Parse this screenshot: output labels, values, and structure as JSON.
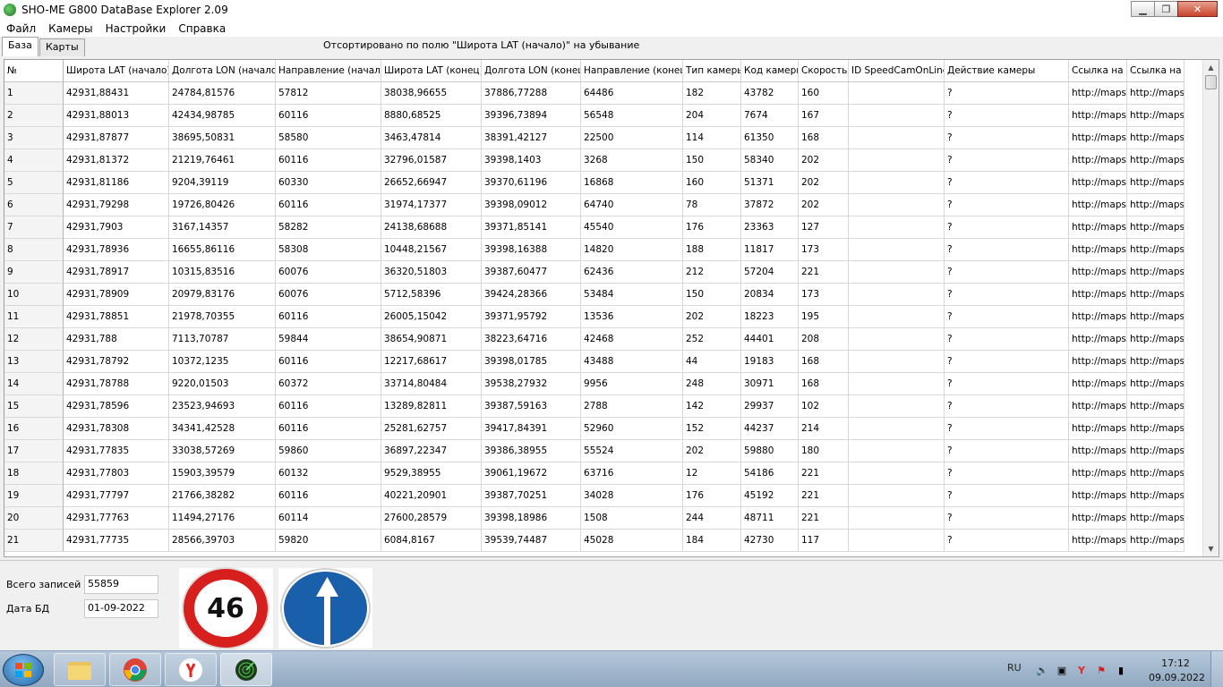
{
  "window": {
    "title": "SHO-ME G800 DataBase Explorer 2.09",
    "minimize_symbol": "▁",
    "maximize_symbol": "❐",
    "close_symbol": "✕"
  },
  "menu": [
    "Файл",
    "Камеры",
    "Настройки",
    "Справка"
  ],
  "tabs": [
    {
      "label": "База",
      "active": true
    },
    {
      "label": "Карты",
      "active": false
    }
  ],
  "sort_info": "Отсортировано по полю \"Широта LAT (начало)\" на убывание",
  "table": {
    "columns": [
      "№",
      "Широта LAT (начало)",
      "Долгота LON (начало)",
      "Направление (начало)",
      "Широта LAT (конец)",
      "Долгота LON (конец)",
      "Направление (конец)",
      "Тип камеры",
      "Код камеры",
      "Скорость",
      "ID SpeedCamOnLine",
      "Действие камеры",
      "Ссылка на Google",
      "Ссылка на Яндекс"
    ],
    "rows": [
      [
        "1",
        "42931,88431",
        "24784,81576",
        "57812",
        "38038,96655",
        "37886,77288",
        "64486",
        "182",
        "43782",
        "160",
        "",
        "?",
        "http://maps.",
        "http://maps."
      ],
      [
        "2",
        "42931,88013",
        "42434,98785",
        "60116",
        "8880,68525",
        "39396,73894",
        "56548",
        "204",
        "7674",
        "167",
        "",
        "?",
        "http://maps.",
        "http://maps."
      ],
      [
        "3",
        "42931,87877",
        "38695,50831",
        "58580",
        "3463,47814",
        "38391,42127",
        "22500",
        "114",
        "61350",
        "168",
        "",
        "?",
        "http://maps.",
        "http://maps."
      ],
      [
        "4",
        "42931,81372",
        "21219,76461",
        "60116",
        "32796,01587",
        "39398,1403",
        "3268",
        "150",
        "58340",
        "202",
        "",
        "?",
        "http://maps.",
        "http://maps."
      ],
      [
        "5",
        "42931,81186",
        "9204,39119",
        "60330",
        "26652,66947",
        "39370,61196",
        "16868",
        "160",
        "51371",
        "202",
        "",
        "?",
        "http://maps.",
        "http://maps."
      ],
      [
        "6",
        "42931,79298",
        "19726,80426",
        "60116",
        "31974,17377",
        "39398,09012",
        "64740",
        "78",
        "37872",
        "202",
        "",
        "?",
        "http://maps.",
        "http://maps."
      ],
      [
        "7",
        "42931,7903",
        "3167,14357",
        "58282",
        "24138,68688",
        "39371,85141",
        "45540",
        "176",
        "23363",
        "127",
        "",
        "?",
        "http://maps.",
        "http://maps."
      ],
      [
        "8",
        "42931,78936",
        "16655,86116",
        "58308",
        "10448,21567",
        "39398,16388",
        "14820",
        "188",
        "11817",
        "173",
        "",
        "?",
        "http://maps.",
        "http://maps."
      ],
      [
        "9",
        "42931,78917",
        "10315,83516",
        "60076",
        "36320,51803",
        "39387,60477",
        "62436",
        "212",
        "57204",
        "221",
        "",
        "?",
        "http://maps.",
        "http://maps."
      ],
      [
        "10",
        "42931,78909",
        "20979,83176",
        "60076",
        "5712,58396",
        "39424,28366",
        "53484",
        "150",
        "20834",
        "173",
        "",
        "?",
        "http://maps.",
        "http://maps."
      ],
      [
        "11",
        "42931,78851",
        "21978,70355",
        "60116",
        "26005,15042",
        "39371,95792",
        "13536",
        "202",
        "18223",
        "195",
        "",
        "?",
        "http://maps.",
        "http://maps."
      ],
      [
        "12",
        "42931,788",
        "7113,70787",
        "59844",
        "38654,90871",
        "38223,64716",
        "42468",
        "252",
        "44401",
        "208",
        "",
        "?",
        "http://maps.",
        "http://maps."
      ],
      [
        "13",
        "42931,78792",
        "10372,1235",
        "60116",
        "12217,68617",
        "39398,01785",
        "43488",
        "44",
        "19183",
        "168",
        "",
        "?",
        "http://maps.",
        "http://maps."
      ],
      [
        "14",
        "42931,78788",
        "9220,01503",
        "60372",
        "33714,80484",
        "39538,27932",
        "9956",
        "248",
        "30971",
        "168",
        "",
        "?",
        "http://maps.",
        "http://maps."
      ],
      [
        "15",
        "42931,78596",
        "23523,94693",
        "60116",
        "13289,82811",
        "39387,59163",
        "2788",
        "142",
        "29937",
        "102",
        "",
        "?",
        "http://maps.",
        "http://maps."
      ],
      [
        "16",
        "42931,78308",
        "34341,42528",
        "60116",
        "25281,62757",
        "39417,84391",
        "52960",
        "152",
        "44237",
        "214",
        "",
        "?",
        "http://maps.",
        "http://maps."
      ],
      [
        "17",
        "42931,77835",
        "33038,57269",
        "59860",
        "36897,22347",
        "39386,38955",
        "55524",
        "202",
        "59880",
        "180",
        "",
        "?",
        "http://maps.",
        "http://maps."
      ],
      [
        "18",
        "42931,77803",
        "15903,39579",
        "60132",
        "9529,38955",
        "39061,19672",
        "63716",
        "12",
        "54186",
        "221",
        "",
        "?",
        "http://maps.",
        "http://maps."
      ],
      [
        "19",
        "42931,77797",
        "21766,38282",
        "60116",
        "40221,20901",
        "39387,70251",
        "34028",
        "176",
        "45192",
        "221",
        "",
        "?",
        "http://maps.",
        "http://maps."
      ],
      [
        "20",
        "42931,77763",
        "11494,27176",
        "60114",
        "27600,28579",
        "39398,18986",
        "1508",
        "244",
        "48711",
        "221",
        "",
        "?",
        "http://maps.",
        "http://maps."
      ],
      [
        "21",
        "42931,77735",
        "28566,39703",
        "59820",
        "6084,8167",
        "39539,74487",
        "45028",
        "184",
        "42730",
        "117",
        "",
        "?",
        "http://maps.",
        "http://maps."
      ]
    ]
  },
  "footer": {
    "total_label": "Всего записей",
    "total_value": "55859",
    "date_label": "Дата БД",
    "date_value": "01-09-2022",
    "speed_sign_value": "46"
  },
  "taskbar": {
    "items": [
      "explorer-icon",
      "chrome-icon",
      "yandex-icon",
      "sho-me-app-icon"
    ],
    "language": "RU",
    "time": "17:12",
    "date": "09.09.2022"
  },
  "colors": {
    "speed_sign_red": "#d7201e",
    "direction_sign_blue": "#1a5faa"
  }
}
